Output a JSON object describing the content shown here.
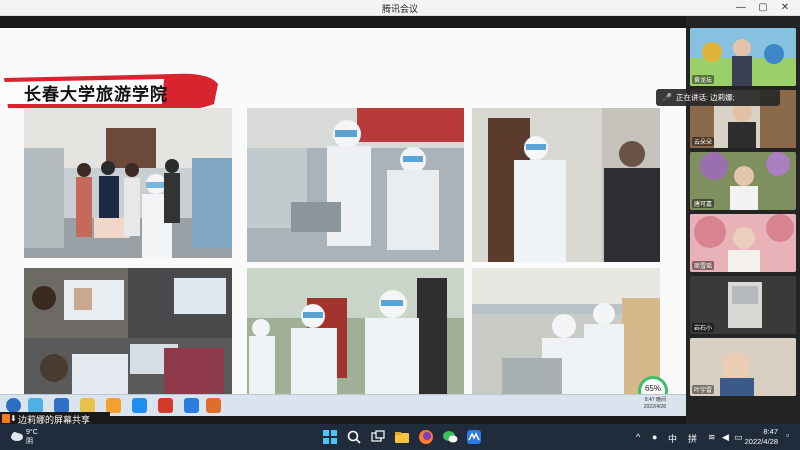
{
  "window": {
    "title": "腾讯会议",
    "controls": [
      "—",
      "▢",
      "✕"
    ]
  },
  "slide": {
    "title": "长春大学旅游学院",
    "banner_color": "#d8242f",
    "photos": [
      "photo-students-with-volunteer",
      "photo-medical-team-seated",
      "photo-volunteer-at-door",
      "photo-online-class-laptops",
      "photo-volunteers-outdoor",
      "photo-supermarket-volunteers"
    ]
  },
  "inner_taskbar": {
    "tray_time": "8:47 晚间",
    "tray_date": "2022/4/28",
    "gauge_value": "65%",
    "gauge_sub": "↑ 364K/s"
  },
  "screen_share": {
    "label": "边莉娜的屏幕共享"
  },
  "speaking": {
    "text": "正在讲话: 边莉娜;"
  },
  "participants": [
    {
      "name": "黄龙坛"
    },
    {
      "name": "云朵朵"
    },
    {
      "name": "唐可嘉"
    },
    {
      "name": "商雪瑶"
    },
    {
      "name": "岩石小"
    },
    {
      "name": "叶宇雷"
    }
  ],
  "taskbar": {
    "temp": "9°C",
    "weather": "阴",
    "ime_lang": "中",
    "ime_mode": "拼",
    "time": "8:47",
    "date": "2022/4/28"
  }
}
